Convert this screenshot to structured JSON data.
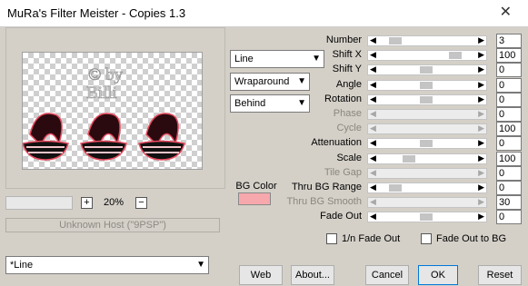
{
  "window": {
    "title": "MuRa's Filter Meister - Copies 1.3",
    "close_glyph": "✕"
  },
  "preview": {
    "watermark": "© by Billi"
  },
  "zoom": {
    "minus_label": "+",
    "value": "20%",
    "plus_label": "−"
  },
  "host_text": "Unknown Host (\"9PSP\")",
  "dropdowns": {
    "shape": "Line",
    "edge": "Wraparound",
    "mode": "Behind",
    "preset": "*Line"
  },
  "bg_color": {
    "label": "BG Color",
    "value": "#f7a8ad"
  },
  "params": [
    {
      "label": "Number",
      "value": "3",
      "level": 0.12,
      "disabled": false
    },
    {
      "label": "Shift X",
      "value": "100",
      "level": 0.82,
      "disabled": false
    },
    {
      "label": "Shift Y",
      "value": "0",
      "level": 0.48,
      "disabled": false
    },
    {
      "label": "Angle",
      "value": "0",
      "level": 0.48,
      "disabled": false
    },
    {
      "label": "Rotation",
      "value": "0",
      "level": 0.48,
      "disabled": false
    },
    {
      "label": "Phase",
      "value": "0",
      "level": null,
      "disabled": true
    },
    {
      "label": "Cycle",
      "value": "100",
      "level": null,
      "disabled": true
    },
    {
      "label": "Attenuation",
      "value": "0",
      "level": 0.48,
      "disabled": false
    },
    {
      "label": "Scale",
      "value": "100",
      "level": 0.28,
      "disabled": false
    },
    {
      "label": "Tile Gap",
      "value": "0",
      "level": null,
      "disabled": true
    },
    {
      "label": "Thru BG Range",
      "value": "0",
      "level": 0.12,
      "disabled": false
    },
    {
      "label": "Thru BG Smooth",
      "value": "30",
      "level": null,
      "disabled": true
    },
    {
      "label": "Fade Out",
      "value": "0",
      "level": 0.48,
      "disabled": false
    }
  ],
  "checkboxes": {
    "fade_1n": "1/n Fade Out",
    "fade_bg": "Fade Out to BG"
  },
  "buttons": {
    "web": "Web",
    "about": "About...",
    "cancel": "Cancel",
    "ok": "OK",
    "reset": "Reset"
  }
}
